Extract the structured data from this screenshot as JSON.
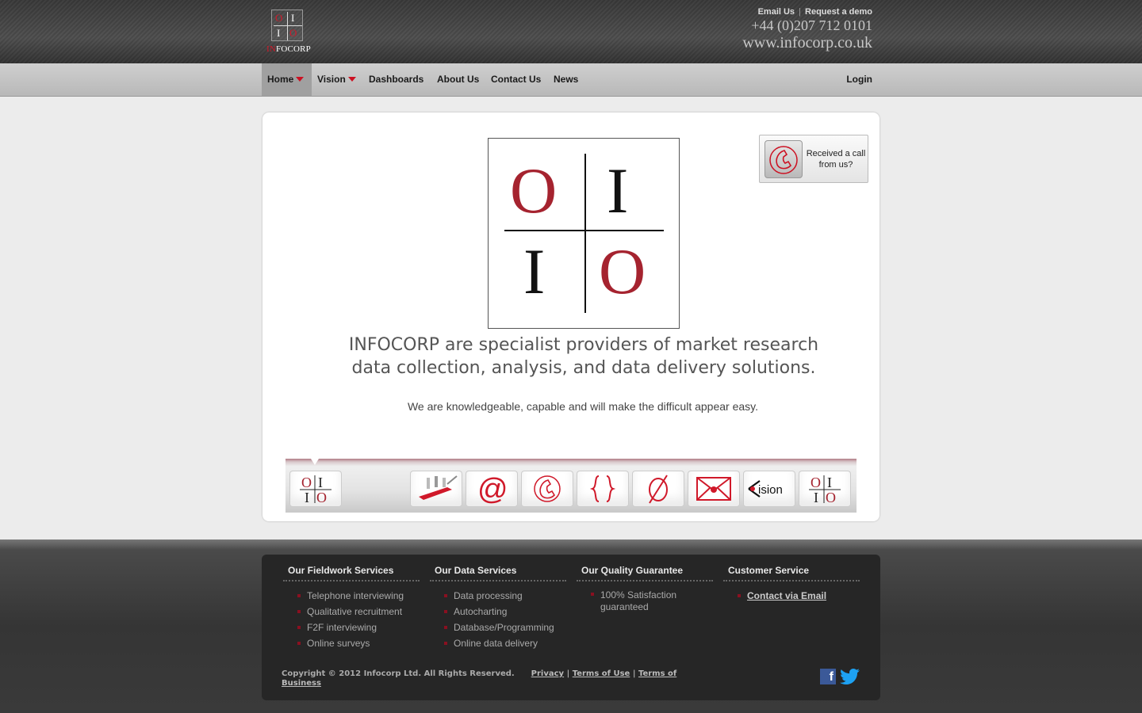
{
  "header": {
    "logo_top_left": "O",
    "logo_top_right": "I",
    "logo_bottom_left": "I",
    "logo_bottom_right": "O",
    "logo_word_in": "IN",
    "logo_word_rest": "FOCORP",
    "email_link": "Email Us",
    "separator": "|",
    "demo_link": "Request a demo",
    "phone": "+44 (0)207 712 0101",
    "website": "www.infocorp.co.uk"
  },
  "nav": {
    "items": [
      {
        "label": "Home"
      },
      {
        "label": "Vision"
      },
      {
        "label": "Dashboards"
      },
      {
        "label": "About Us"
      },
      {
        "label": "Contact Us"
      },
      {
        "label": "News"
      }
    ],
    "login": "Login"
  },
  "hero": {
    "logo_top_left": "O",
    "logo_top_right": "I",
    "logo_bottom_left": "I",
    "logo_bottom_right": "O",
    "callback_line1": "Received a call",
    "callback_line2": "from us?",
    "tagline_line1": "INFOCORP are specialist providers of market research",
    "tagline_line2": "data collection, analysis, and data delivery solutions.",
    "subline": "We are knowledgeable, capable and will make the difficult appear easy."
  },
  "strip": {
    "tiles": [
      {
        "icon": "infocorp-logo-icon"
      },
      {
        "icon": "swiss-army-knife-icon"
      },
      {
        "icon": "at-sign-icon"
      },
      {
        "icon": "telephone-icon"
      },
      {
        "icon": "curly-braces-icon"
      },
      {
        "icon": "empty-set-icon"
      },
      {
        "icon": "envelope-icon"
      },
      {
        "icon": "vision-logo-icon",
        "text": "ision"
      },
      {
        "icon": "infocorp-logo-icon"
      }
    ]
  },
  "footer": {
    "columns": [
      {
        "title": "Our Fieldwork Services",
        "items": [
          "Telephone interviewing",
          "Qualitative recruitment",
          "F2F interviewing",
          "Online surveys"
        ]
      },
      {
        "title": "Our Data Services",
        "items": [
          "Data processing",
          "Autocharting",
          "Database/Programming",
          "Online data delivery"
        ]
      },
      {
        "title": "Our Quality Guarantee",
        "items": [
          "100% Satisfaction guaranteed"
        ]
      },
      {
        "title": "Customer Service",
        "items": [
          "Contact via Email"
        ]
      }
    ],
    "copyright": "Copyright © 2012 Infocorp Ltd. All Rights Reserved.",
    "privacy": "Privacy",
    "terms_use": "Terms of Use",
    "terms_business": "Terms of Business",
    "sep": "|",
    "facebook_glyph": "f"
  },
  "colors": {
    "brand_red": "#cc1122",
    "header_dark": "#444444",
    "footer_box": "#262626"
  }
}
